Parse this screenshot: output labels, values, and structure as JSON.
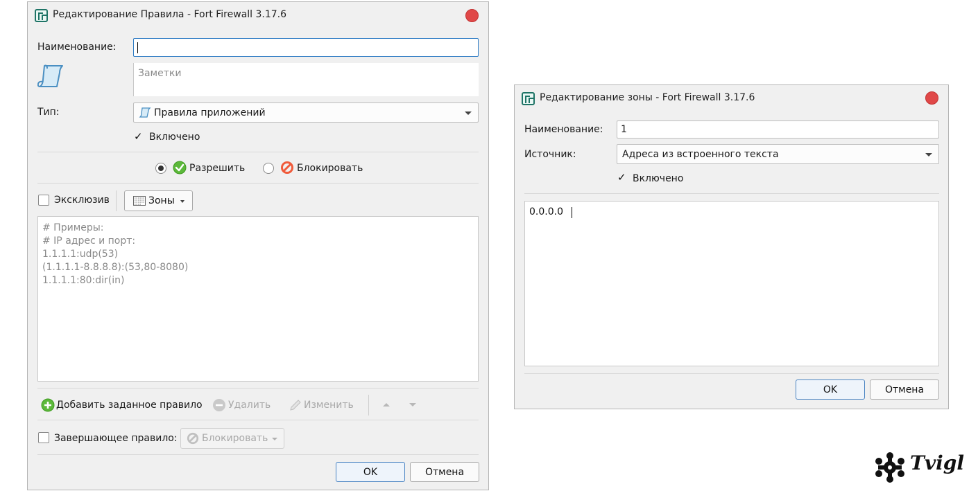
{
  "rule_dialog": {
    "title": "Редактирование Правила - Fort Firewall 3.17.6",
    "name_label": "Наименование:",
    "name_value": "",
    "notes_placeholder": "Заметки",
    "type_label": "Тип:",
    "type_value": "Правила приложений",
    "enabled_label": "Включено",
    "enabled": true,
    "allow_label": "Разрешить",
    "block_label": "Блокировать",
    "selected_action": "allow",
    "exclusive_label": "Эксклюзив",
    "exclusive": false,
    "zones_label": "Зоны",
    "rule_text_lines": [
      "# Примеры:",
      "# IP адрес и порт:",
      "1.1.1.1:udp(53)",
      "(1.1.1.1-8.8.8.8):(53,80-8080)",
      "1.1.1.1:80:dir(in)"
    ],
    "add_rule_label": "Добавить заданное правило",
    "delete_label": "Удалить",
    "edit_label": "Изменить",
    "final_rule_label": "Завершающее правило:",
    "final_rule": false,
    "final_rule_value": "Блокировать",
    "ok_label": "OK",
    "cancel_label": "Отмена"
  },
  "zone_dialog": {
    "title": "Редактирование зоны - Fort Firewall 3.17.6",
    "name_label": "Наименование:",
    "name_value": "1",
    "source_label": "Источник:",
    "source_value": "Адреса из встроенного текста",
    "enabled_label": "Включено",
    "enabled": true,
    "text_value": "0.0.0.0",
    "ok_label": "OK",
    "cancel_label": "Отмена"
  },
  "watermark": {
    "text": "Tvigl"
  },
  "colors": {
    "focus_blue": "#2f7cc4",
    "close_red": "#e04848",
    "allow_green": "#5cb83a",
    "block_red": "#f05a3a",
    "brand_teal": "#1e7466"
  }
}
